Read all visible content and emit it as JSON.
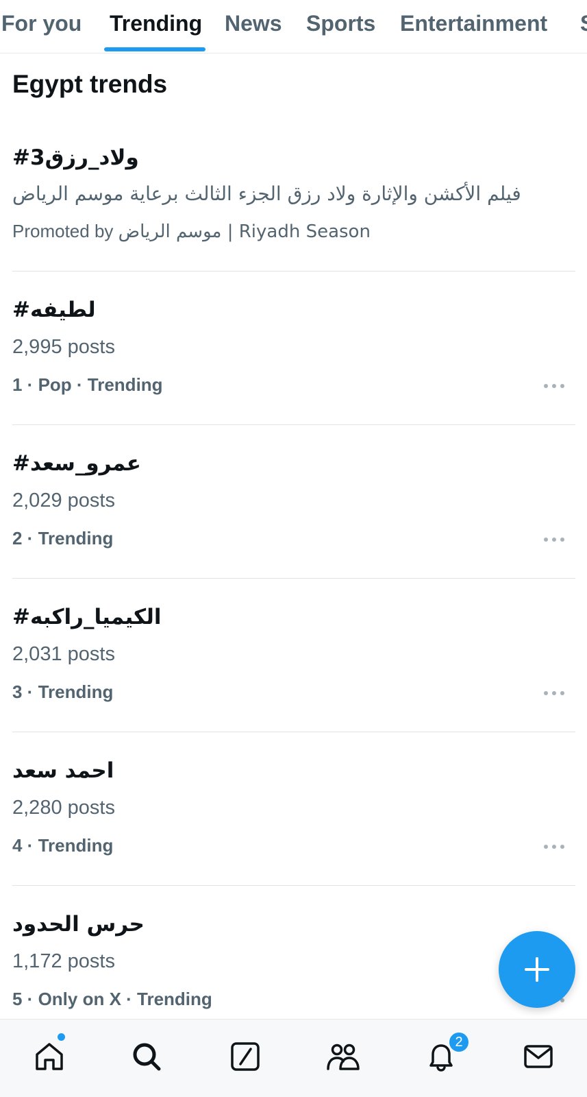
{
  "tabs": [
    {
      "label": "For you"
    },
    {
      "label": "Trending"
    },
    {
      "label": "News"
    },
    {
      "label": "Sports"
    },
    {
      "label": "Entertainment"
    },
    {
      "label": "S"
    }
  ],
  "active_tab": "Trending",
  "section_title": "Egypt trends",
  "promoted": {
    "name": "#ولاد_رزق3",
    "description": "فيلم الأكشن والإثارة ولاد رزق الجزء الثالث برعاية موسم الرياض",
    "promoted_by_label": "Promoted by",
    "promoted_by_name": "موسم الرياض | Riyadh Season"
  },
  "trends": [
    {
      "name": "#لطيفه",
      "posts": "2,995 posts",
      "meta": "1 · Pop · Trending"
    },
    {
      "name": "#عمرو_سعد",
      "posts": "2,029 posts",
      "meta": "2 · Trending"
    },
    {
      "name": "#الكيميا_راكبه",
      "posts": "2,031 posts",
      "meta": "3 · Trending"
    },
    {
      "name": "احمد سعد",
      "posts": "2,280 posts",
      "meta": "4 · Trending"
    },
    {
      "name": "حرس الحدود",
      "posts": "1,172 posts",
      "meta": "5 · Only on X · Trending"
    }
  ],
  "nav": {
    "items": [
      "home-icon",
      "search-icon",
      "grok-icon",
      "communities-icon",
      "notifications-icon",
      "messages-icon"
    ],
    "notification_count": "2"
  },
  "fab_icon": "plus-icon",
  "colors": {
    "accent": "#1d9bf0",
    "secondary_text": "#536471",
    "primary_text": "#0f1419"
  }
}
